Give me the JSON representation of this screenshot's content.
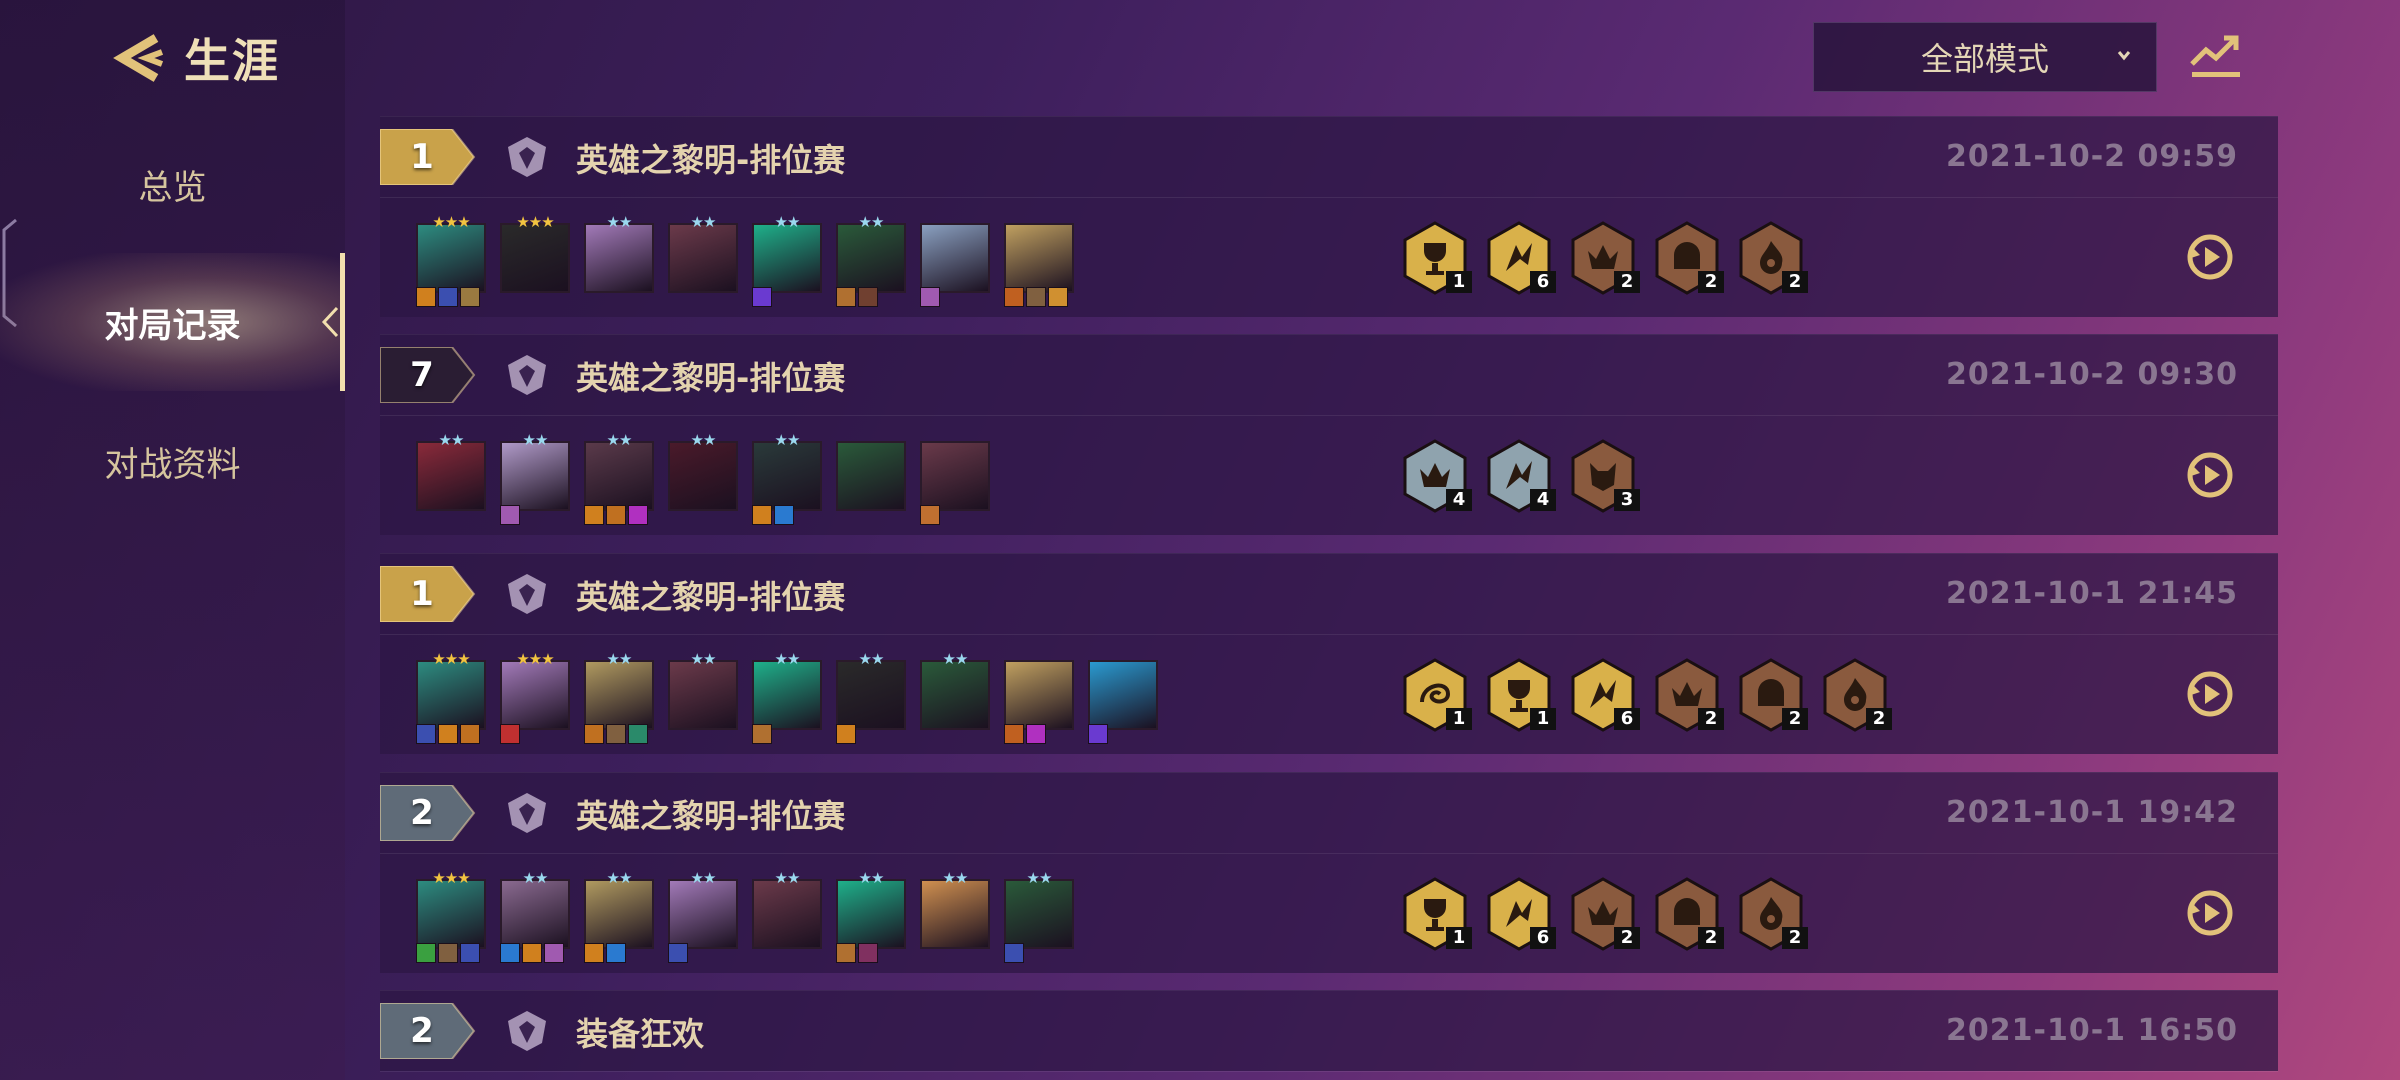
{
  "sidebar": {
    "title": "生涯",
    "nav": [
      {
        "label": "总览",
        "active": false
      },
      {
        "label": "对局记录",
        "active": true
      },
      {
        "label": "对战资料",
        "active": false
      }
    ]
  },
  "toolbar": {
    "mode_select": "全部模式"
  },
  "colors": {
    "gold": "#c9a24a",
    "silver": "#5f6b78",
    "dark": "#2a1d33",
    "trait_gold": "#d9b14a",
    "trait_bronze": "#8a5a3e",
    "trait_silver": "#8fa3ae"
  },
  "matches": [
    {
      "rank": "1",
      "rank_tier": "gold",
      "mode": "英雄之黎明-排位赛",
      "time": "2021-10-2 09:59",
      "units": [
        {
          "stars": 3,
          "color": "#2d8c80",
          "items": [
            "#d0801e",
            "#3b4fb0",
            "#9a7a40"
          ]
        },
        {
          "stars": 3,
          "color": "#2a2a2a",
          "items": []
        },
        {
          "stars": 2,
          "color": "#a27ab8",
          "items": []
        },
        {
          "stars": 2,
          "color": "#6b3a4a",
          "items": []
        },
        {
          "stars": 2,
          "color": "#1fb08a",
          "items": [
            "#6a3ad0"
          ]
        },
        {
          "stars": 2,
          "color": "#2a5a3a",
          "items": [
            "#b07030",
            "#704030"
          ]
        },
        {
          "stars": 0,
          "color": "#8aa0c0",
          "items": [
            "#a05ab0"
          ]
        },
        {
          "stars": 0,
          "color": "#c0a060",
          "items": [
            "#c06020",
            "#806040",
            "#d09030"
          ]
        }
      ],
      "traits": [
        {
          "tier": "gold",
          "icon": "trophy-icon",
          "count": "1"
        },
        {
          "tier": "gold",
          "icon": "wing-icon",
          "count": "6"
        },
        {
          "tier": "bronze",
          "icon": "crown-icon",
          "count": "2"
        },
        {
          "tier": "bronze",
          "icon": "helm-icon",
          "count": "2"
        },
        {
          "tier": "bronze",
          "icon": "flame-icon",
          "count": "2"
        }
      ]
    },
    {
      "rank": "7",
      "rank_tier": "dark",
      "mode": "英雄之黎明-排位赛",
      "time": "2021-10-2 09:30",
      "units": [
        {
          "stars": 2,
          "color": "#8a2a3a",
          "items": []
        },
        {
          "stars": 2,
          "color": "#b09ac8",
          "items": [
            "#a05ab0"
          ]
        },
        {
          "stars": 2,
          "color": "#5a3a4a",
          "items": [
            "#d0801e",
            "#c07020",
            "#b030c0"
          ]
        },
        {
          "stars": 2,
          "color": "#4a1a2a",
          "items": []
        },
        {
          "stars": 2,
          "color": "#2a3a3a",
          "items": [
            "#d0801e",
            "#2a7ad0"
          ]
        },
        {
          "stars": 0,
          "color": "#2a5a3a",
          "items": []
        },
        {
          "stars": 0,
          "color": "#6a3a4a",
          "items": [
            "#c07030"
          ]
        }
      ],
      "traits": [
        {
          "tier": "silver",
          "icon": "crown-icon",
          "count": "4"
        },
        {
          "tier": "silver",
          "icon": "wing-icon",
          "count": "4"
        },
        {
          "tier": "bronze",
          "icon": "beast-icon",
          "count": "3"
        }
      ]
    },
    {
      "rank": "1",
      "rank_tier": "gold",
      "mode": "英雄之黎明-排位赛",
      "time": "2021-10-1 21:45",
      "units": [
        {
          "stars": 3,
          "color": "#2d8c80",
          "items": [
            "#3b4fb0",
            "#d0801e",
            "#c07020"
          ]
        },
        {
          "stars": 3,
          "color": "#a27ab8",
          "items": [
            "#c03030"
          ]
        },
        {
          "stars": 2,
          "color": "#b09a60",
          "items": [
            "#c07020",
            "#806040",
            "#2a8a6a"
          ]
        },
        {
          "stars": 2,
          "color": "#6b3a4a",
          "items": []
        },
        {
          "stars": 2,
          "color": "#1fb08a",
          "items": [
            "#b07030"
          ]
        },
        {
          "stars": 2,
          "color": "#2a2a2a",
          "items": [
            "#d0801e"
          ]
        },
        {
          "stars": 2,
          "color": "#2a5a3a",
          "items": []
        },
        {
          "stars": 0,
          "color": "#c0a060",
          "items": [
            "#c06020",
            "#b030c0"
          ]
        },
        {
          "stars": 0,
          "color": "#2a9ad0",
          "items": [
            "#6a3ad0"
          ]
        }
      ],
      "traits": [
        {
          "tier": "gold",
          "icon": "swirl-icon",
          "count": "1"
        },
        {
          "tier": "gold",
          "icon": "trophy-icon",
          "count": "1"
        },
        {
          "tier": "gold",
          "icon": "wing-icon",
          "count": "6"
        },
        {
          "tier": "bronze",
          "icon": "crown-icon",
          "count": "2"
        },
        {
          "tier": "bronze",
          "icon": "helm-icon",
          "count": "2"
        },
        {
          "tier": "bronze",
          "icon": "flame-icon",
          "count": "2"
        }
      ]
    },
    {
      "rank": "2",
      "rank_tier": "silver",
      "mode": "英雄之黎明-排位赛",
      "time": "2021-10-1 19:42",
      "units": [
        {
          "stars": 3,
          "color": "#2d8c80",
          "items": [
            "#3aa040",
            "#806040",
            "#3b4fb0"
          ]
        },
        {
          "stars": 2,
          "color": "#8a6a90",
          "items": [
            "#2a7ad0",
            "#d0801e",
            "#a05ab0"
          ]
        },
        {
          "stars": 2,
          "color": "#b09a60",
          "items": [
            "#d0801e",
            "#2a7ad0"
          ]
        },
        {
          "stars": 2,
          "color": "#a27ab8",
          "items": [
            "#3b4fb0"
          ]
        },
        {
          "stars": 2,
          "color": "#6b3a4a",
          "items": []
        },
        {
          "stars": 2,
          "color": "#1fb08a",
          "items": [
            "#b07030",
            "#803060"
          ]
        },
        {
          "stars": 2,
          "color": "#d09050",
          "items": []
        },
        {
          "stars": 2,
          "color": "#2a5a3a",
          "items": [
            "#3b4fb0"
          ]
        }
      ],
      "traits": [
        {
          "tier": "gold",
          "icon": "trophy-icon",
          "count": "1"
        },
        {
          "tier": "gold",
          "icon": "wing-icon",
          "count": "6"
        },
        {
          "tier": "bronze",
          "icon": "crown-icon",
          "count": "2"
        },
        {
          "tier": "bronze",
          "icon": "helm-icon",
          "count": "2"
        },
        {
          "tier": "bronze",
          "icon": "flame-icon",
          "count": "2"
        }
      ]
    },
    {
      "rank": "2",
      "rank_tier": "silver",
      "mode": "装备狂欢",
      "time": "2021-10-1 16:50",
      "units": [],
      "traits": []
    }
  ]
}
